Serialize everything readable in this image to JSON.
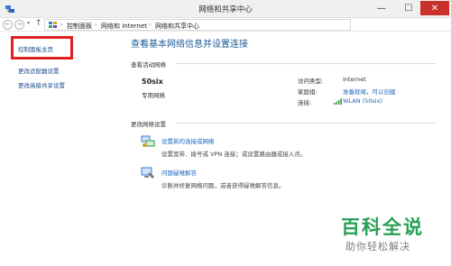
{
  "window": {
    "title": "网络和共享中心",
    "controls": {
      "minimize": "—",
      "maximize": "☐",
      "close": "✕"
    }
  },
  "address_bar": {
    "back_glyph": "←",
    "forward_glyph": "→",
    "recent_glyph": "▾",
    "up_glyph": "↑",
    "breadcrumbs": [
      "控制面板",
      "网络和 Internet",
      "网络和共享中心"
    ],
    "separator": "›"
  },
  "sidebar": {
    "items": [
      {
        "label": "控制面板主页",
        "highlighted": true
      },
      {
        "label": "更改适配器设置"
      },
      {
        "label": "更改高级共享设置"
      }
    ],
    "highlight_color": "#e02020"
  },
  "main": {
    "title": "查看基本网络信息并设置连接",
    "active_networks": {
      "heading": "查看活动网络",
      "network_name": "50six",
      "network_type": "专用网络",
      "details": [
        {
          "key": "访问类型:",
          "value": "Internet"
        },
        {
          "key": "家庭组:",
          "value": "准备就绪，可以创建"
        },
        {
          "key": "连接:",
          "value": "WLAN (50six)"
        }
      ]
    },
    "change_settings": {
      "heading": "更改网络设置",
      "tasks": [
        {
          "title": "设置新的连接或网络",
          "description": "设置宽带、拨号或 VPN 连接；或设置路由器或接入点。",
          "icon": "network-setup-icon"
        },
        {
          "title": "问题疑难解答",
          "description": "诊断并修复网络问题，或者获得疑难解答信息。",
          "icon": "troubleshoot-icon"
        }
      ]
    }
  },
  "watermark": {
    "title": "百科全说",
    "subtitle": "助你轻松解决"
  },
  "colors": {
    "link": "#1a66c2",
    "title": "#1c5a9a",
    "close_button": "#c9322b",
    "watermark": "#26a055"
  }
}
